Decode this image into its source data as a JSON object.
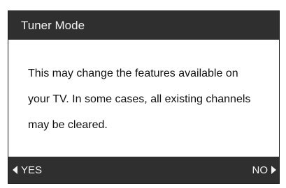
{
  "dialog": {
    "title": "Tuner Mode",
    "message": "This may change the features available on your TV. In some cases, all existing channels may be cleared."
  },
  "options": {
    "yes_label": "YES",
    "yes_icon": "left-triangle-icon",
    "no_label": "NO",
    "no_icon": "right-triangle-icon"
  },
  "colors": {
    "frame": "#2f2f2f",
    "content_bg": "#ffffff",
    "frame_text": "#f2f2f2",
    "body_text": "#111111"
  }
}
